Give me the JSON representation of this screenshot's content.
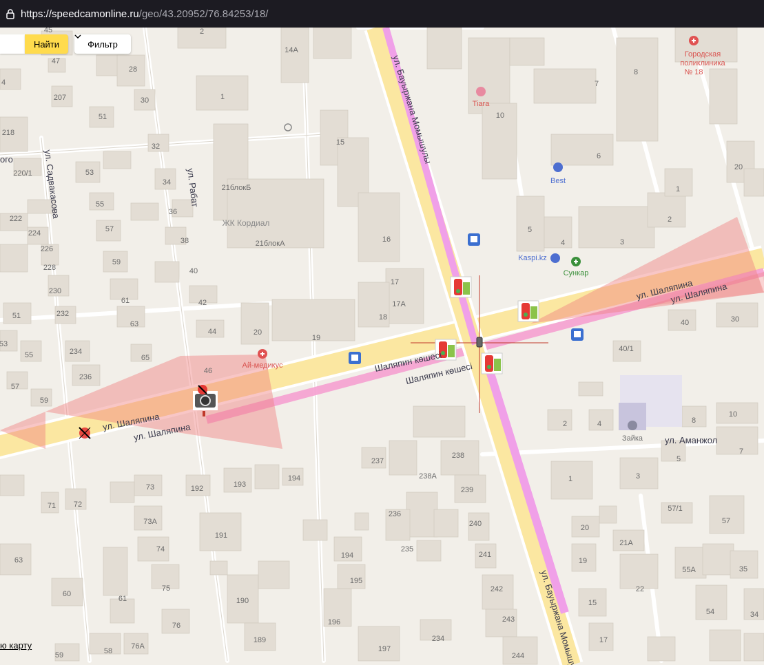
{
  "browser": {
    "url_host": "https://speedcamonline.ru",
    "url_path": "/geo/43.20952/76.84253/18/"
  },
  "toolbar": {
    "find_label": "Найти",
    "filter_label": "Фильтр"
  },
  "footer": {
    "map_link_partial": "ю карту"
  },
  "streets": {
    "shalyapina_1": "ул. Шаляпина",
    "shalyapina_2": "ул. Шаляпина",
    "shalyapina_3": "ул. Шаляпина",
    "shalyapina_4": "ул. Шаляпина",
    "shalyapin_kaz_1": "Шаляпин көшесі",
    "shalyapin_kaz_2": "Шаляпин көшесі",
    "momyshuly_1": "ул. Бауыржана Момышулы",
    "momyshuly_2": "ул. Бауыржана Момышулы",
    "sadvakasova": "ул. Садвакасова",
    "rabat": "ул. Рабат",
    "amanzhol": "ул. Аманжол",
    "edge_left": "ого"
  },
  "pois": {
    "clinic": "Городская поликлиника № 18",
    "tiara": "Tiara",
    "best": "Best",
    "kaspi": "Kaspi.kz",
    "sunkar": "Сункар",
    "ai_medikus": "Ай-медикус",
    "zhk": "ЖК Кордиал",
    "zaika": "Зайка"
  },
  "house_numbers": {
    "h2": "2",
    "h14a": "14А",
    "h45": "45",
    "h47": "47",
    "h28": "28",
    "h4": "4",
    "h207": "207",
    "h30": "30",
    "h1a": "1",
    "h51": "51",
    "h218": "218",
    "h32": "32",
    "h220": "220/1",
    "h53": "53",
    "h34": "34",
    "h222": "222",
    "h55": "55",
    "h36": "36",
    "h224": "224",
    "h57": "57",
    "h38": "38",
    "h226": "226",
    "h228": "228",
    "h59": "59",
    "h40": "40",
    "h230": "230",
    "h61": "61",
    "h42": "42",
    "h51b": "51",
    "h232": "232",
    "h63": "63",
    "h44": "44",
    "h53b": "53",
    "h55b": "55",
    "h234": "234",
    "h65": "65",
    "h236": "236",
    "h46": "46",
    "h57b": "57",
    "h59b": "59",
    "h20": "20",
    "h19": "19",
    "h21b": "21блокБ",
    "h21a": "21блокА",
    "h15": "15",
    "h16": "16",
    "h17": "17",
    "h17a": "17А",
    "h18": "18",
    "h10": "10",
    "h8": "8",
    "h7": "7",
    "h6": "6",
    "h5": "5",
    "h4b": "4",
    "h3": "3",
    "h2b": "2",
    "h1b": "1",
    "h20b": "20",
    "h40b": "40",
    "h30b": "30",
    "h40_1": "40/1",
    "h2c": "2",
    "h4c": "4",
    "h8b": "8",
    "h10b": "10",
    "h7b": "7",
    "h5b": "5",
    "h3b": "3",
    "h1c": "1",
    "h237": "237",
    "h238": "238",
    "h238a": "238А",
    "h239": "239",
    "h236b": "236",
    "h240": "240",
    "h235": "235",
    "h241": "241",
    "h194": "194",
    "h195": "195",
    "h242": "242",
    "h243": "243",
    "h196": "196",
    "h234b": "234",
    "h244": "244",
    "h197": "197",
    "h193": "193",
    "h194b": "194",
    "h192": "192",
    "h73": "73",
    "h71": "71",
    "h72": "72",
    "h73a": "73А",
    "h191": "191",
    "h74": "74",
    "h63b": "63",
    "h75": "75",
    "h60": "60",
    "h61b": "61",
    "h190": "190",
    "h76": "76",
    "h189": "189",
    "h59c": "59",
    "h58": "58",
    "h76a": "76А",
    "h57_1": "57/1",
    "h57c": "57",
    "h20c": "20",
    "h21a2": "21А",
    "h19b": "19",
    "h55a": "55А",
    "h35": "35",
    "h22": "22",
    "h15b": "15",
    "h54": "54",
    "h34b": "34",
    "h17b": "17",
    "h16b": "16",
    "h20d": "20",
    "h1d": "1"
  },
  "colors": {
    "map_bg": "#f2efe9",
    "building": "#e3ddd4",
    "building_side": "#d6cfc5",
    "road_main": "#fbe7a1",
    "road_pink": "#f0a0e0",
    "camera_zone": "#f08080",
    "find_button": "#ffdb4d",
    "url_bar": "#1c1b22"
  }
}
